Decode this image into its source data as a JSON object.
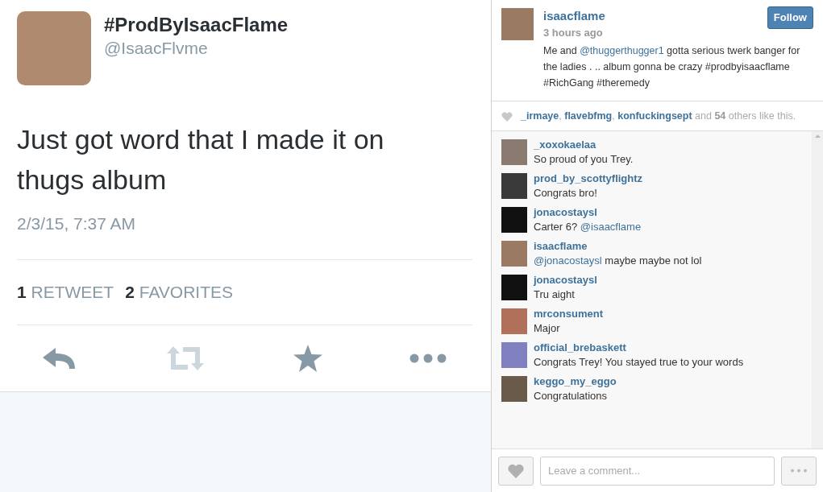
{
  "tweet": {
    "display_name": "#ProdByIsaacFlame",
    "handle": "@IsaacFlvme",
    "text": "Just got word that I made it on thugs album",
    "timestamp": "2/3/15, 7:37 AM",
    "stats": [
      {
        "count": "1",
        "label": "RETWEET"
      },
      {
        "count": "2",
        "label": "FAVORITES"
      }
    ],
    "actions": [
      {
        "kind": "reply"
      },
      {
        "kind": "retweet"
      },
      {
        "kind": "favorite"
      },
      {
        "kind": "more"
      }
    ]
  },
  "post": {
    "username": "isaacflame",
    "time": "3 hours ago",
    "follow_button": "Follow",
    "caption": [
      {
        "kind": "text",
        "text": "Me and "
      },
      {
        "kind": "mention",
        "text": "@thuggerthugger1"
      },
      {
        "kind": "text",
        "text": " gotta serious twerk banger for the ladies . .. album gonna be crazy #prodbyisaacflame #RichGang #theremedy"
      }
    ],
    "likes": [
      {
        "kind": "user",
        "text": "_irmaye"
      },
      {
        "kind": "text",
        "text": ", "
      },
      {
        "kind": "user",
        "text": "flavebfmg"
      },
      {
        "kind": "text",
        "text": ", "
      },
      {
        "kind": "user",
        "text": "konfuckingsept"
      },
      {
        "kind": "text",
        "text": " and "
      },
      {
        "kind": "count",
        "text": "54"
      },
      {
        "kind": "text",
        "text": " others like this."
      }
    ],
    "comments": [
      {
        "user": "_xoxokaelaa",
        "parts": [
          {
            "kind": "text",
            "text": "So proud of you Trey."
          }
        ]
      },
      {
        "user": "prod_by_scottyflightz",
        "parts": [
          {
            "kind": "text",
            "text": "Congrats bro!"
          }
        ]
      },
      {
        "user": "jonacostaysl",
        "parts": [
          {
            "kind": "text",
            "text": "Carter 6? "
          },
          {
            "kind": "mention",
            "text": "@isaacflame"
          }
        ]
      },
      {
        "user": "isaacflame",
        "parts": [
          {
            "kind": "mention",
            "text": "@jonacostaysl"
          },
          {
            "kind": "text",
            "text": " maybe maybe not lol"
          }
        ]
      },
      {
        "user": "jonacostaysl",
        "parts": [
          {
            "kind": "text",
            "text": "Tru aight"
          }
        ]
      },
      {
        "user": "mrconsument",
        "parts": [
          {
            "kind": "text",
            "text": "Major"
          }
        ]
      },
      {
        "user": "official_brebaskett",
        "parts": [
          {
            "kind": "text",
            "text": "Congrats Trey! You stayed true to your words"
          }
        ]
      },
      {
        "user": "keggo_my_eggo",
        "parts": [
          {
            "kind": "text",
            "text": "Congratulations"
          }
        ]
      }
    ],
    "comment_field": {
      "placeholder": "Leave a comment..."
    }
  }
}
